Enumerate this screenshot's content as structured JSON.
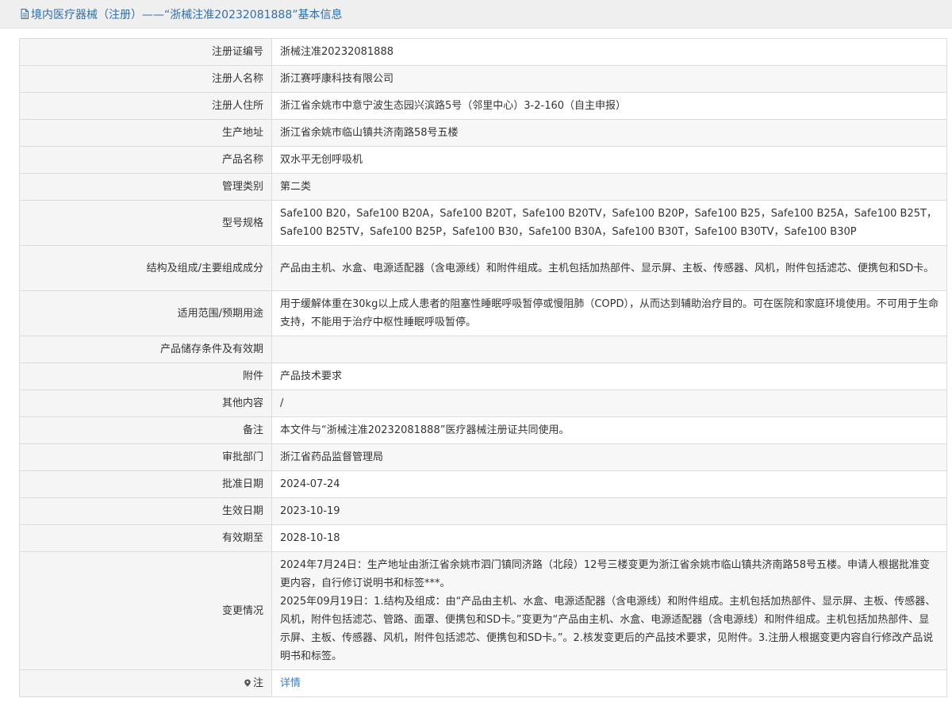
{
  "header": {
    "title": "境内医疗器械（注册）——“浙械注准20232081888”基本信息"
  },
  "rows": [
    {
      "label": "注册证编号",
      "value": "浙械注准20232081888"
    },
    {
      "label": "注册人名称",
      "value": "浙江赛呼康科技有限公司"
    },
    {
      "label": "注册人住所",
      "value": "浙江省余姚市中意宁波生态园兴滨路5号（邻里中心）3-2-160（自主申报）"
    },
    {
      "label": "生产地址",
      "value": "浙江省余姚市临山镇共济南路58号五楼"
    },
    {
      "label": "产品名称",
      "value": "双水平无创呼吸机"
    },
    {
      "label": "管理类别",
      "value": "第二类"
    },
    {
      "label": "型号规格",
      "value": "Safe100 B20，Safe100 B20A，Safe100 B20T，Safe100 B20TV，Safe100 B20P，Safe100 B25，Safe100 B25A，Safe100 B25T，Safe100 B25TV，Safe100 B25P，Safe100 B30，Safe100 B30A，Safe100 B30T，Safe100 B30TV，Safe100 B30P"
    },
    {
      "label": "结构及组成/主要组成成分",
      "value": "产品由主机、水盒、电源适配器（含电源线）和附件组成。主机包括加热部件、显示屏、主板、传感器、风机，附件包括滤芯、便携包和SD卡。"
    },
    {
      "label": "适用范围/预期用途",
      "value": "用于缓解体重在30kg以上成人患者的阻塞性睡眠呼吸暂停或慢阻肺（COPD），从而达到辅助治疗目的。可在医院和家庭环境使用。不可用于生命支持，不能用于治疗中枢性睡眠呼吸暂停。"
    },
    {
      "label": "产品储存条件及有效期",
      "value": ""
    },
    {
      "label": "附件",
      "value": "产品技术要求"
    },
    {
      "label": "其他内容",
      "value": "/"
    },
    {
      "label": "备注",
      "value": "本文件与“浙械注准20232081888”医疗器械注册证共同使用。"
    },
    {
      "label": "审批部门",
      "value": "浙江省药品监督管理局"
    },
    {
      "label": "批准日期",
      "value": "2024-07-24"
    },
    {
      "label": "生效日期",
      "value": "2023-10-19"
    },
    {
      "label": "有效期至",
      "value": "2028-10-18"
    },
    {
      "label": "变更情况",
      "value_lines": [
        "2024年7月24日：生产地址由浙江省余姚市泗门镇同济路（北段）12号三楼变更为浙江省余姚市临山镇共济南路58号五楼。申请人根据批准变更内容，自行修订说明书和标签***。",
        "2025年09月19日：1.结构及组成：由“产品由主机、水盒、电源适配器（含电源线）和附件组成。主机包括加热部件、显示屏、主板、传感器、风机，附件包括滤芯、管路、面罩、便携包和SD卡。”变更为“产品由主机、水盒、电源适配器（含电源线）和附件组成。主机包括加热部件、显示屏、主板、传感器、风机，附件包括滤芯、便携包和SD卡。”。2.核发变更后的产品技术要求，见附件。3.注册人根据变更内容自行修改产品说明书和标签。"
      ]
    },
    {
      "label": "注",
      "value": "详情",
      "icon": "location-pin-icon"
    }
  ]
}
